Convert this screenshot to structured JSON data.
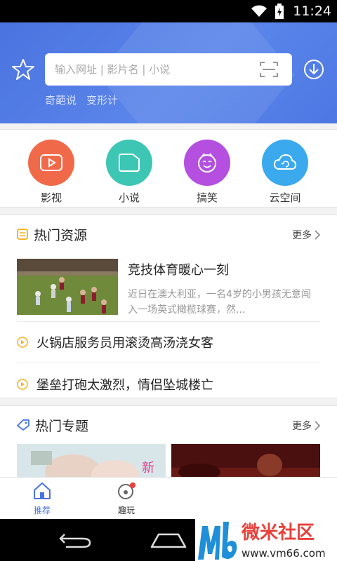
{
  "status_bar": {
    "time": "11:24"
  },
  "header": {
    "search_placeholder": "输入网址 | 影片名 | 小说",
    "hot_words": [
      "奇葩说",
      "变形计"
    ]
  },
  "categories": [
    {
      "label": "影视",
      "color": "#f06a4a",
      "icon": "video-play-icon"
    },
    {
      "label": "小说",
      "color": "#3ec6b4",
      "icon": "book-icon"
    },
    {
      "label": "搞笑",
      "color": "#b44fe0",
      "icon": "smiley-icon"
    },
    {
      "label": "云空间",
      "color": "#3aa9ee",
      "icon": "cloud-icon"
    }
  ],
  "hot_resources": {
    "title": "热门资源",
    "more": "更多",
    "feature": {
      "title": "竞技体育暖心一刻",
      "desc": "近日在澳大利亚，一名4岁的小男孩无意闯入一场英式橄榄球赛，然..."
    },
    "items": [
      "火锅店服务员用滚烫高汤浇女客",
      "堡垒打砲太激烈，情侣坠城楼亡"
    ]
  },
  "hot_topics": {
    "title": "热门专题",
    "more": "更多"
  },
  "bottom_nav": [
    {
      "label": "推荐",
      "active": true
    },
    {
      "label": "趣玩",
      "active": false
    }
  ],
  "watermark": {
    "brand": "微米社区",
    "url": "www.vm66.com"
  },
  "colors": {
    "accent": "#4a73e0",
    "orange": "#f5b52a"
  }
}
